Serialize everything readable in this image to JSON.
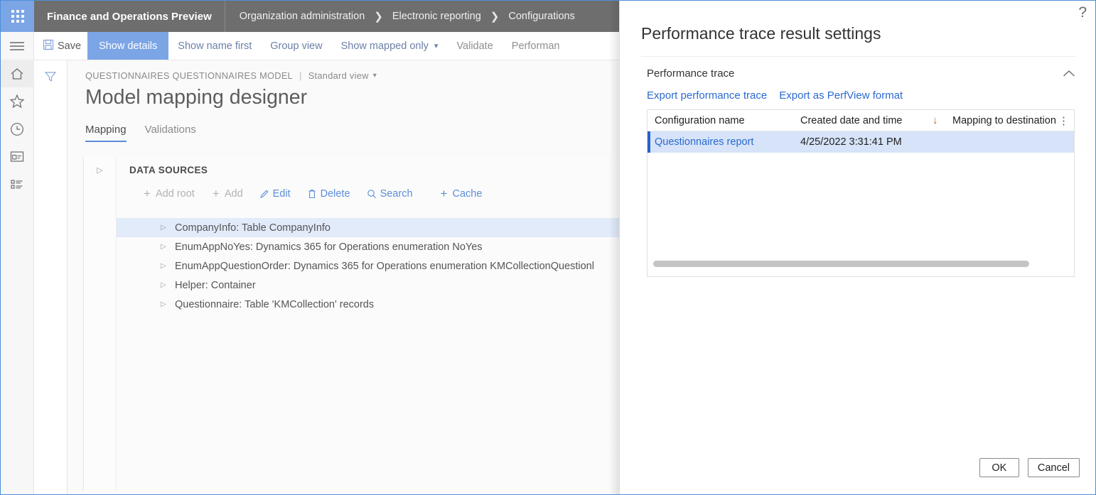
{
  "topbar": {
    "app_launcher_icon": "waffle-grid-icon",
    "app_title": "Finance and Operations Preview",
    "breadcrumb": [
      {
        "label": "Organization administration"
      },
      {
        "label": "Electronic reporting"
      },
      {
        "label": "Configurations"
      }
    ],
    "separator": "❯"
  },
  "rail": {
    "items": [
      {
        "name": "navigation-menu",
        "icon": "hamburger-icon"
      },
      {
        "name": "home",
        "icon": "home-icon",
        "active": true
      },
      {
        "name": "favorites",
        "icon": "star-icon"
      },
      {
        "name": "recent",
        "icon": "clock-icon"
      },
      {
        "name": "workspaces",
        "icon": "workspace-icon"
      },
      {
        "name": "modules",
        "icon": "list-icon"
      }
    ]
  },
  "command_bar": {
    "save_label": "Save",
    "save_icon": "save-disk-icon",
    "items": [
      {
        "label": "Show details",
        "state": "active"
      },
      {
        "label": "Show name first",
        "state": "link"
      },
      {
        "label": "Group view",
        "state": "link"
      },
      {
        "label": "Show mapped only",
        "state": "link",
        "has_dropdown": true
      },
      {
        "label": "Validate",
        "state": "dim"
      },
      {
        "label": "Performan",
        "state": "dim",
        "truncated": true
      }
    ]
  },
  "filter_column": {
    "icon": "filter-funnel-icon"
  },
  "page": {
    "context_label": "QUESTIONNAIRES QUESTIONNAIRES MODEL",
    "context_separator": "|",
    "view_selector": "Standard view",
    "title": "Model mapping designer",
    "tabs": [
      {
        "label": "Mapping",
        "active": true
      },
      {
        "label": "Validations",
        "active": false
      }
    ]
  },
  "data_sources": {
    "caption": "DATA SOURCES",
    "expand_caret": "▷",
    "actions": [
      {
        "label": "Add root",
        "icon": "plus-icon",
        "disabled": true
      },
      {
        "label": "Add",
        "icon": "plus-icon",
        "disabled": true
      },
      {
        "label": "Edit",
        "icon": "pencil-icon",
        "disabled": false
      },
      {
        "label": "Delete",
        "icon": "trash-icon",
        "disabled": false
      },
      {
        "label": "Search",
        "icon": "search-icon",
        "disabled": false
      },
      {
        "label": "Cache",
        "icon": "plus-icon",
        "disabled": false
      }
    ],
    "tree": [
      {
        "label": "CompanyInfo: Table CompanyInfo",
        "selected": true
      },
      {
        "label": "EnumAppNoYes: Dynamics 365 for Operations enumeration NoYes",
        "selected": false
      },
      {
        "label": "EnumAppQuestionOrder: Dynamics 365 for Operations enumeration KMCollectionQuestionl",
        "selected": false
      },
      {
        "label": "Helper: Container",
        "selected": false
      },
      {
        "label": "Questionnaire: Table 'KMCollection' records",
        "selected": false
      }
    ]
  },
  "dialog": {
    "help_icon": "question-mark-icon",
    "title": "Performance trace result settings",
    "section": {
      "title": "Performance trace",
      "collapse_icon": "chevron-up-icon"
    },
    "links": [
      {
        "label": "Export performance trace"
      },
      {
        "label": "Export as PerfView format"
      }
    ],
    "grid": {
      "columns": [
        {
          "label": "Configuration name"
        },
        {
          "label": "Created date and time",
          "sort": "descending",
          "sort_icon": "↓"
        },
        {
          "label": "Mapping to destination"
        }
      ],
      "column_menu_icon": "vertical-ellipsis-icon",
      "rows": [
        {
          "configuration_name": "Questionnaires report",
          "created_date_and_time": "4/25/2022 3:31:41 PM",
          "mapping_to_destination": "",
          "selected": true
        }
      ],
      "horizontal_scrollbar": true
    },
    "buttons": [
      {
        "label": "OK",
        "name": "ok-button"
      },
      {
        "label": "Cancel",
        "name": "cancel-button"
      }
    ]
  },
  "colors": {
    "topbar_bg": "#6e6e6e",
    "accent_blue": "#7ca5e6",
    "link_blue": "#2b6ad0",
    "selected_row_bg": "#d6e3f8",
    "selected_accent": "#2563c9",
    "tree_selected_bg": "#e2ebfa",
    "sort_arrow": "#b06a2c"
  }
}
